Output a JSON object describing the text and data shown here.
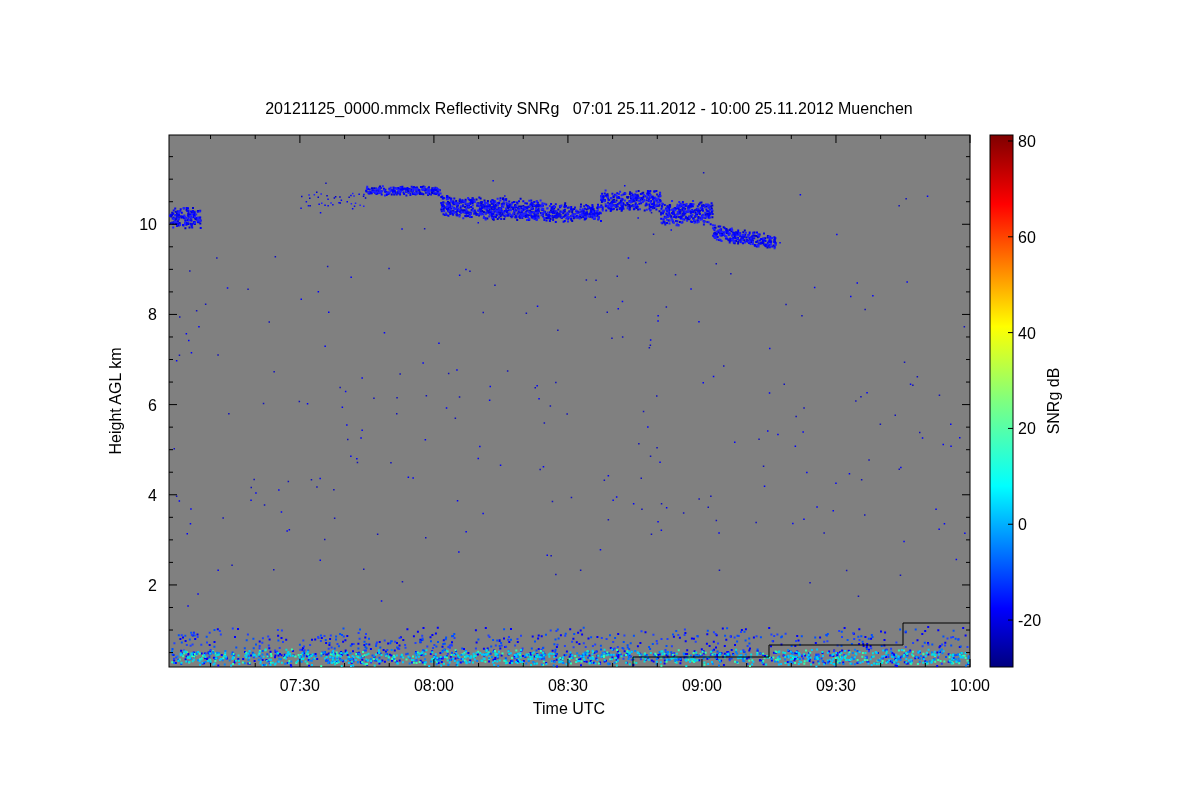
{
  "title": "20121125_0000.mmclx Reflectivity SNRg   07:01 25.11.2012 - 10:00 25.11.2012 Muenchen",
  "x_axis": {
    "label": "Time UTC",
    "ticks": [
      "07:30",
      "08:00",
      "08:30",
      "09:00",
      "09:30",
      "10:00"
    ]
  },
  "y_axis": {
    "label": "Height AGL km",
    "ticks": [
      "10",
      "8",
      "6",
      "4",
      "2"
    ]
  },
  "colorbar": {
    "label": "SNRg dB",
    "ticks": [
      "80",
      "60",
      "40",
      "20",
      "0",
      "-20"
    ]
  }
}
